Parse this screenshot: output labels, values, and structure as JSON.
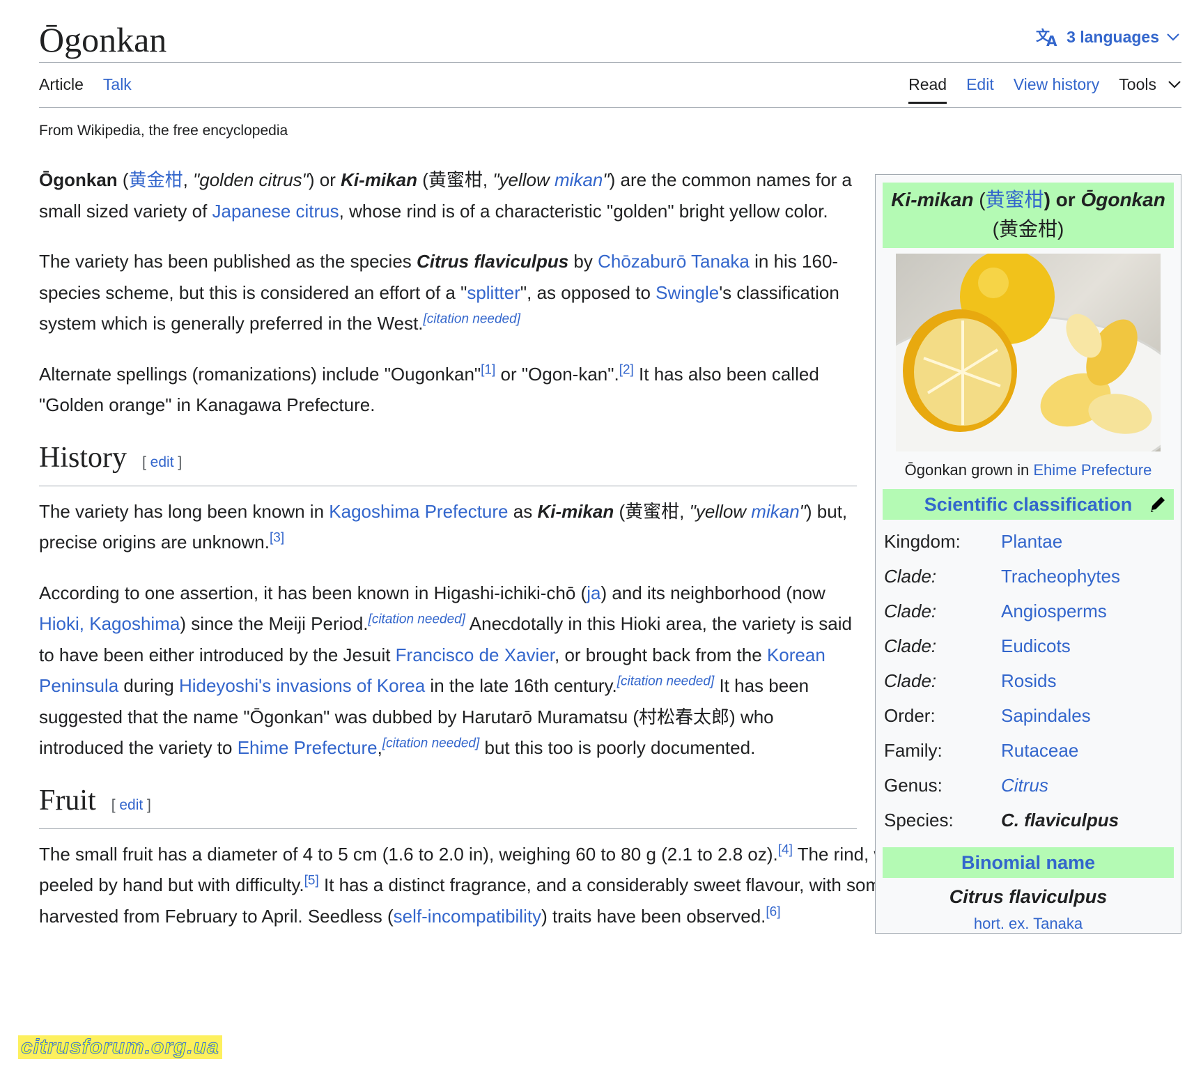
{
  "title": "Ōgonkan",
  "languages": {
    "label": "3 languages"
  },
  "tabs_left": [
    {
      "label": "Article"
    },
    {
      "label": "Talk"
    }
  ],
  "tabs_right": [
    {
      "label": "Read"
    },
    {
      "label": "Edit"
    },
    {
      "label": "View history"
    },
    {
      "label": "Tools"
    }
  ],
  "tagline": "From Wikipedia, the free encyclopedia",
  "sections": [
    {
      "heading": "History",
      "edit_label": "edit"
    },
    {
      "heading": "Fruit",
      "edit_label": "edit"
    }
  ],
  "infobox": {
    "title_a": "Ki-mikan",
    "title_b": "(",
    "title_link": "黄蜜柑",
    "title_c": ") or",
    "title_d": "Ōgonkan",
    "title_e": "(黄金柑)",
    "caption_text": "Ōgonkan grown in",
    "caption_link": "Ehime Prefecture",
    "sci_label": "Scientific classification",
    "taxonomy": [
      {
        "rank": "Kingdom:",
        "value": "Plantae"
      },
      {
        "rank": "Clade:",
        "value": "Tracheophytes"
      },
      {
        "rank": "Clade:",
        "value": "Angiosperms"
      },
      {
        "rank": "Clade:",
        "value": "Eudicots"
      },
      {
        "rank": "Clade:",
        "value": "Rosids"
      },
      {
        "rank": "Order:",
        "value": "Sapindales"
      },
      {
        "rank": "Family:",
        "value": "Rutaceae"
      },
      {
        "rank": "Genus:",
        "value": "Citrus"
      },
      {
        "rank": "Species:",
        "value": "C. flaviculpus"
      }
    ],
    "binomial_label": "Binomial name",
    "binomial": "Citrus flaviculpus",
    "authority": "hort. ex. Tanaka"
  },
  "watermark": "citrusforum.org.ua",
  "body": {
    "p1": [
      "Ōgonkan",
      " (",
      "黄金柑",
      ", ",
      "\"golden citrus\"",
      ") or ",
      "Ki-mikan",
      " (黄蜜柑, ",
      "\"yellow ",
      "mikan",
      "\"",
      ") are the common names for a small sized variety of ",
      "Japanese citrus",
      ", whose rind is of a characteristic \"golden\" bright yellow color."
    ],
    "p2": [
      "The variety has been published as the species ",
      "Citrus flaviculpus",
      " by ",
      "Chōzaburō Tanaka",
      " in his 160-species scheme, but this is considered an effort of a \"",
      "splitter",
      "\", as opposed to ",
      "Swingle",
      "'s classification system which is generally preferred in the West.",
      "[citation needed]"
    ],
    "p3": [
      "Alternate spellings (romanizations) include \"Ougonkan\"",
      "[1]",
      " or \"Ogon-kan\".",
      "[2]",
      " It has also been called \"Golden orange\" in Kanagawa Prefecture."
    ],
    "h1": [
      "The variety has long been known in ",
      "Kagoshima Prefecture",
      " as ",
      "Ki-mikan",
      " (黄蜜柑, ",
      "\"yellow ",
      "mikan",
      "\"",
      ") but, precise origins are unknown.",
      "[3]"
    ],
    "h2": [
      "According to one assertion, it has been known in Higashi-ichiki-chō (",
      "ja",
      ") and its neighborhood (now ",
      "Hioki, Kagoshima",
      ") since the Meiji Period.",
      "[citation needed]",
      " Anecdotally in this Hioki area, the variety is said to have been either introduced by the Jesuit ",
      "Francisco de Xavier",
      ", or brought back from the ",
      "Korean Peninsula",
      " during ",
      "Hideyoshi's invasions of Korea",
      " in the late 16th century.",
      "[citation needed]",
      " It has been suggested that the name \"Ōgonkan\" was dubbed by Harutarō Muramatsu (村松春太郎) who introduced the variety to ",
      "Ehime Prefecture",
      ",",
      "[citation needed]",
      " but this too is poorly documented."
    ],
    "f1": [
      "The small fruit has a diameter of 4 to 5 cm (1.6 to 2.0 in), weighing 60 to 80 g (2.1 to 2.8 oz).",
      "[4]",
      " The rind, which is bright yellow, can be peeled by hand but with difficulty.",
      "[5]",
      " It has a distinct fragrance, and a considerably sweet flavour, with some balancing acidity. The fruit is harvested from February to April. Seedless (",
      "self-incompatibility",
      ") traits have been observed.",
      "[6]"
    ]
  }
}
